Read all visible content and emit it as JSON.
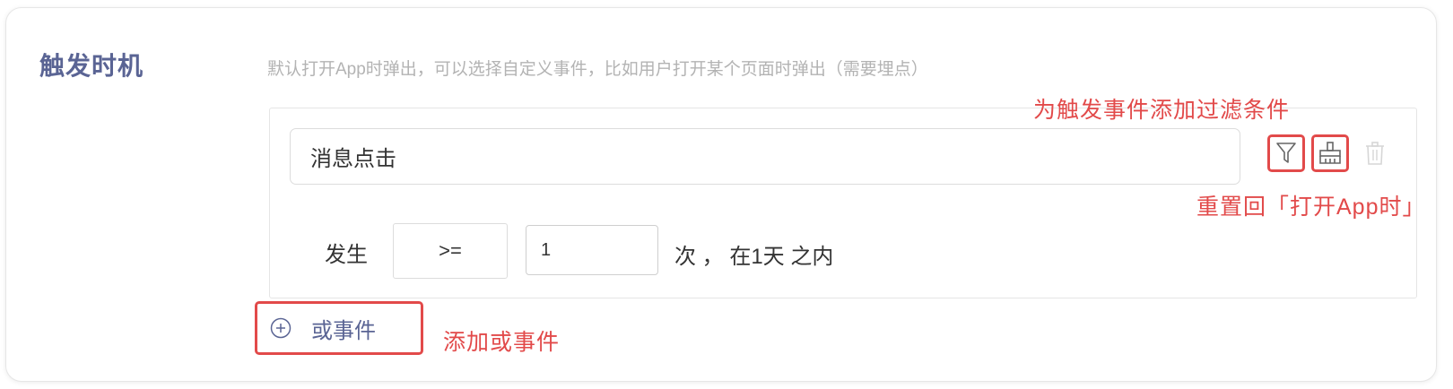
{
  "section": {
    "title": "触发时机",
    "hint": "默认打开App时弹出，可以选择自定义事件，比如用户打开某个页面时弹出（需要埋点）"
  },
  "event": {
    "name": "消息点击",
    "occur_label": "发生",
    "operator": ">=",
    "count": "1",
    "suffix": "次 ， 在1天 之内"
  },
  "actions": {
    "filter_icon": "filter-icon",
    "reset_icon": "broom-icon",
    "delete_icon": "trash-icon"
  },
  "add_or": {
    "icon": "plus-circle-icon",
    "label": "或事件"
  },
  "annotations": {
    "filter": "为触发事件添加过滤条件",
    "reset": "重置回「打开App时」",
    "add_or": "添加或事件"
  },
  "colors": {
    "accent": "#5a6494",
    "annotation": "#e24a4a",
    "hint": "#b3b3b3"
  }
}
